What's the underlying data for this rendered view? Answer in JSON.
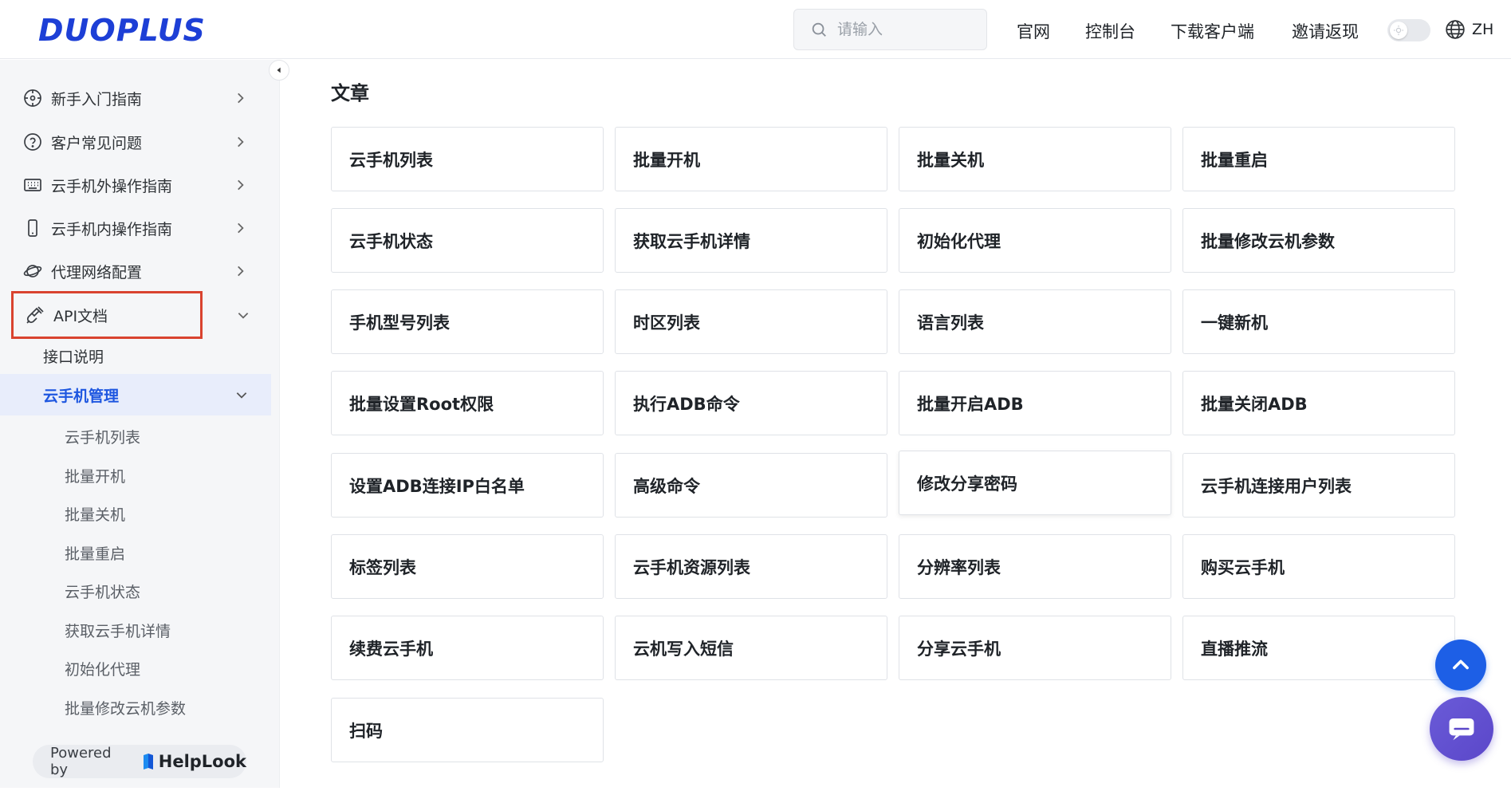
{
  "header": {
    "logo": "DUOPLUS",
    "search_placeholder": "请输入",
    "nav": [
      "官网",
      "控制台",
      "下载客户端",
      "邀请返现"
    ],
    "lang": "ZH"
  },
  "sidebar": {
    "items": [
      {
        "label": "新手入门指南",
        "icon": "compass-icon"
      },
      {
        "label": "客户常见问题",
        "icon": "question-circle-icon"
      },
      {
        "label": "云手机外操作指南",
        "icon": "keyboard-icon"
      },
      {
        "label": "云手机内操作指南",
        "icon": "phone-icon"
      },
      {
        "label": "代理网络配置",
        "icon": "planet-icon"
      },
      {
        "label": "API文档",
        "icon": "plug-icon"
      }
    ],
    "api_children": {
      "intro": "接口说明",
      "group": "云手机管理",
      "leaves": [
        "云手机列表",
        "批量开机",
        "批量关机",
        "批量重启",
        "云手机状态",
        "获取云手机详情",
        "初始化代理",
        "批量修改云机参数"
      ]
    },
    "powered_by": "Powered by",
    "powered_brand": "HelpLook"
  },
  "main": {
    "title": "文章",
    "cards": [
      "云手机列表",
      "批量开机",
      "批量关机",
      "批量重启",
      "云手机状态",
      "获取云手机详情",
      "初始化代理",
      "批量修改云机参数",
      "手机型号列表",
      "时区列表",
      "语言列表",
      "一键新机",
      "批量设置Root权限",
      "执行ADB命令",
      "批量开启ADB",
      "批量关闭ADB",
      "设置ADB连接IP白名单",
      "高级命令",
      "修改分享密码",
      "云手机连接用户列表",
      "标签列表",
      "云手机资源列表",
      "分辨率列表",
      "购买云手机",
      "续费云手机",
      "云机写入短信",
      "分享云手机",
      "直播推流",
      "扫码"
    ]
  },
  "colors": {
    "accent": "#1d56e0",
    "highlight": "#d9432f",
    "chat": "#5b47c9"
  }
}
